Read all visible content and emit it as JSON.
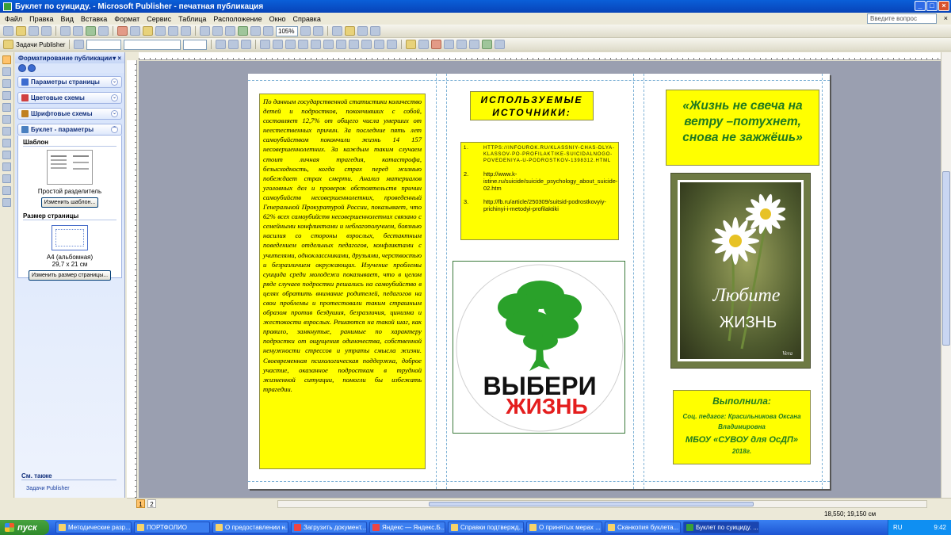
{
  "window": {
    "title": "Буклет по суициду. - Microsoft Publisher - печатная публикация",
    "controls": [
      "_",
      "□",
      "×"
    ]
  },
  "menu": {
    "items": [
      "Файл",
      "Правка",
      "Вид",
      "Вставка",
      "Формат",
      "Сервис",
      "Таблица",
      "Расположение",
      "Окно",
      "Справка"
    ],
    "ask_placeholder": "Введите вопрос",
    "close_glyph": "×"
  },
  "toolbar": {
    "zoom": "105%",
    "tasks_label": "Задачи Publisher"
  },
  "taskpane": {
    "title": "Форматирование публикации",
    "close_glyph": "▾ ×",
    "sections": [
      {
        "label": "Параметры страницы",
        "color": "#3b6bd0"
      },
      {
        "label": "Цветовые схемы",
        "color": "#d04040"
      },
      {
        "label": "Шрифтовые схемы",
        "color": "#c08020"
      },
      {
        "label": "Буклет - параметры",
        "color": "#4a80c0"
      }
    ],
    "template_heading": "Шаблон",
    "template_name": "Простой разделитель",
    "change_template": "Изменить шаблон...",
    "size_heading": "Размер страницы",
    "page_size_name": "A4 (альбомная)",
    "page_size_dims": "29,7 x 21 см",
    "change_size": "Изменить размер страницы...",
    "see_also": "См. также",
    "see_also_link": "Задачи Publisher"
  },
  "page": {
    "stat_text": "По данным государственной статистики количество детей и подростков, покончивших с собой, составляет 12,7% от общего числа умерших от неестественных причин. За последние пять лет самоубийством покончили жизнь 14 157 несовершеннолетних. За каждым таким случаем стоит личная трагедия, катастрофа, безысходность, когда страх перед жизнью побеждает страх смерти. Анализ материалов уголовных дел и проверок обстоятельств причин самоубийств несовершеннолетних, проведенный Генеральной Прокуратурой России, показывает, что 62% всех самоубийств несовершеннолетних связано с семейными конфликтами и неблагополучием, боязнью насилия со стороны взрослых, бестактным поведением отдельных педагогов, конфликтами с учителями, одноклассниками, друзьями, черствостью и безразличием окружающих. Изучение проблемы суицида среди молодежи показывает, что в целом ряде случаев подростки решались на самоубийство в целях обратить внимание родителей, педагогов на свои проблемы и протестовали таким страшным образом против бездушия, безразличия, цинизма и жестокости взрослых. Решаются на такой шаг, как правило, замкнутые, ранимые по характеру подростки от ощущения одиночества, собственной ненужности стрессов и утраты смысла жизни. Своевременная психологическая поддержка, доброе участие, оказанное подросткам в трудной жизненной ситуации, помогли бы избежать трагедии.",
    "sources_title": "ИСПОЛЬЗУЕМЫЕ ИСТОЧНИКИ:",
    "sources": [
      {
        "num": "1.",
        "text": "HTTPS://INFOUROK.RU/KLASSNIY-CHAS-DLYA-KLASSOV-PO-PROFILAKTIKE-SUICIDALNOGO-POVEDENIYA-U-PODROSTKOV-1398312.HTML"
      },
      {
        "num": "2.",
        "text": "http://www.k-istine.ru/suicide/suicide_psychology_about_suicide-02.htm"
      },
      {
        "num": "3.",
        "text": "http://fb.ru/article/250309/suitsid-podrostkovyiy-prichinyi-i-metodyi-profilaktiki"
      }
    ],
    "logo_line1": "ВЫБЕРИ",
    "logo_line2": "ЖИЗНЬ",
    "quote": "«Жизнь не свеча на ветру –потухнет, снова не зажжёшь»",
    "photo_line1": "Любите",
    "photo_line2": "ЖИЗНЬ",
    "photo_sign": "Vera",
    "author_heading": "Выполнила:",
    "author_line": "Соц. педагог:  Красильникова Оксана Владимировна",
    "author_org": "МБОУ «СУВОУ для ОсДП»",
    "author_year": "2018г.",
    "colors": {
      "yellow": "#ffff00",
      "green_text": "#1f7a1f",
      "logo_green": "#2aa12a",
      "logo_red": "#e41e1e"
    }
  },
  "status": {
    "pages": [
      "1",
      "2"
    ],
    "coords": "18,550; 19,150 см"
  },
  "taskbar": {
    "start": "пуск",
    "items": [
      "Методические разр...",
      "ПОРТФОЛИО",
      "О предоставлении н...",
      "Загрузить документ...",
      "Яндекс — Яндекс.Б...",
      "Справки подтвержд...",
      "О принятых мерах ...",
      "Сканкопия буклета...",
      "Буклет по суициду. ..."
    ],
    "lang": "RU",
    "time": "9:42"
  }
}
